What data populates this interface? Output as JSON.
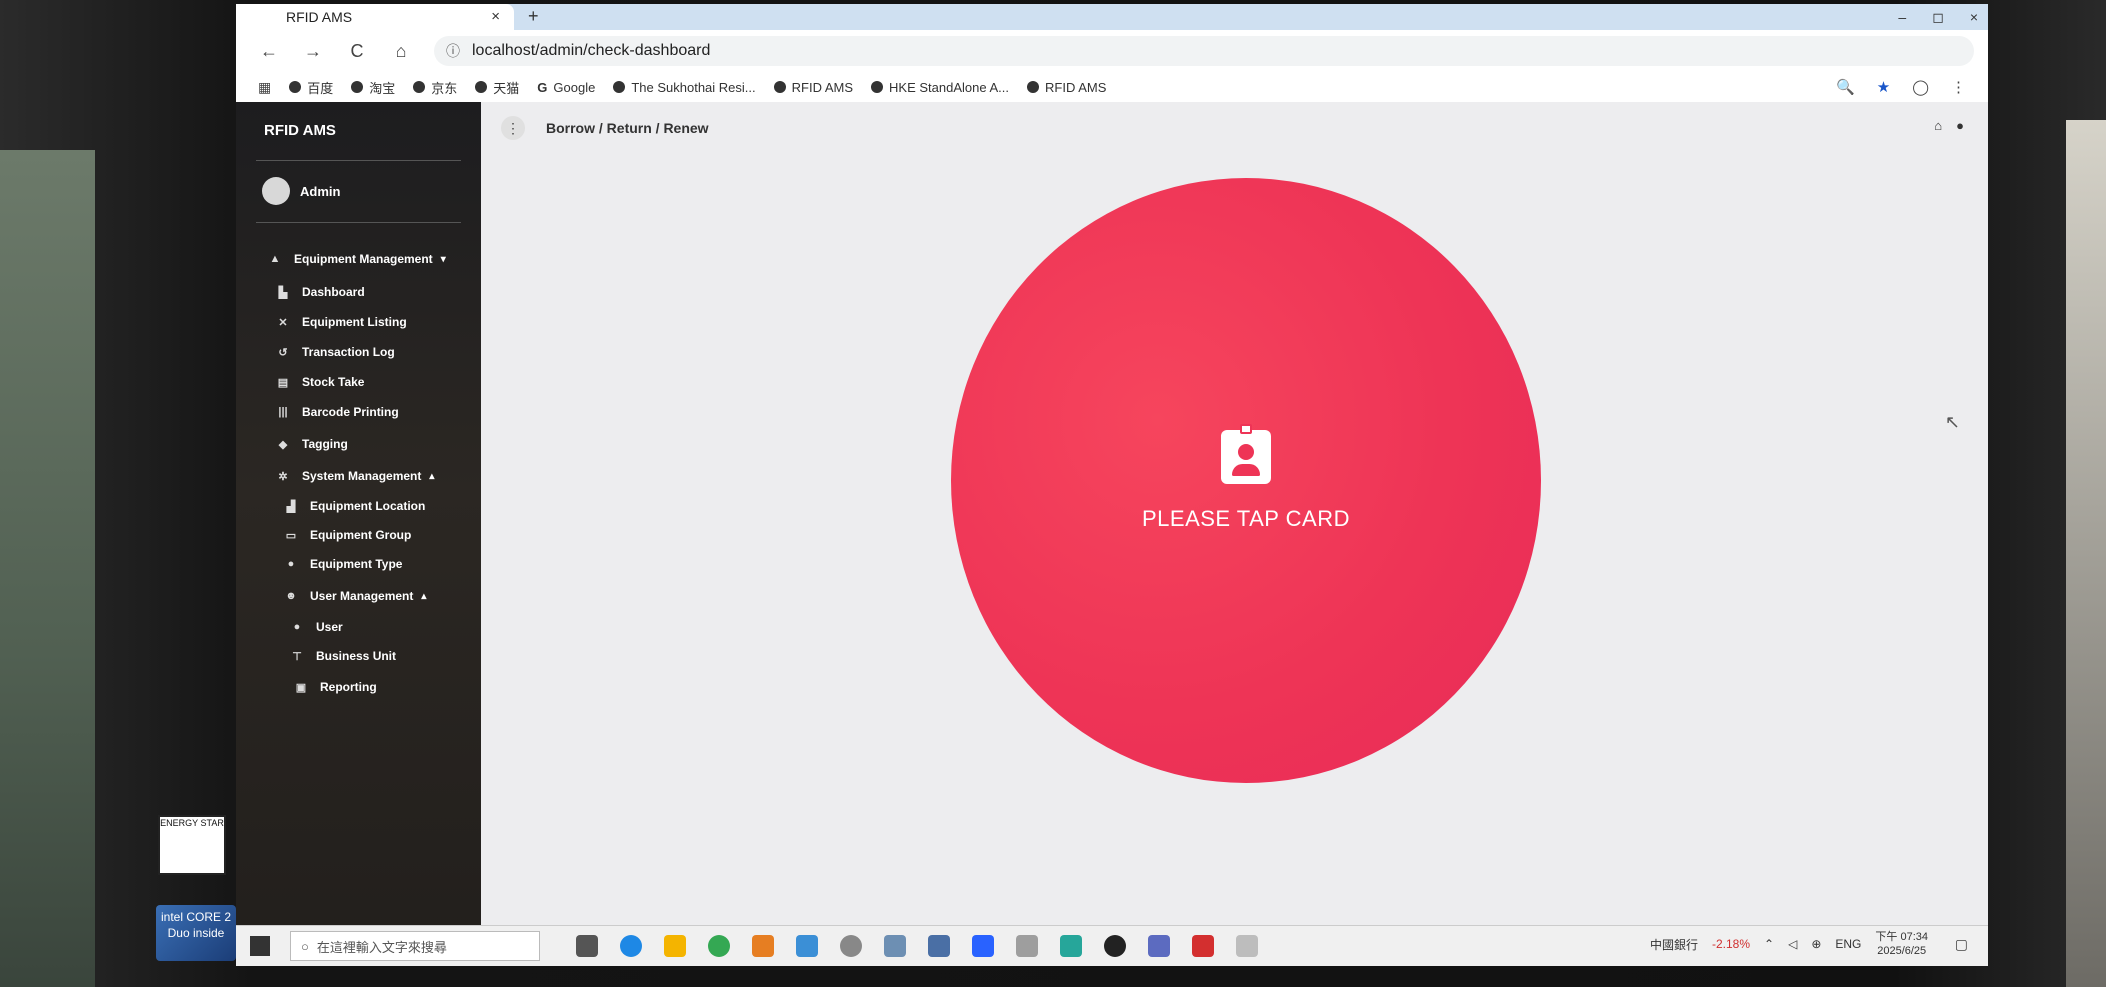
{
  "browser": {
    "tab_title": "RFID AMS",
    "new_tab_symbol": "+",
    "tab_close_symbol": "×",
    "url": "localhost/admin/check-dashboard",
    "nav": {
      "back": "←",
      "forward": "→",
      "reload": "C",
      "home": "⌂"
    },
    "window_controls": [
      "–",
      "◻",
      "×"
    ],
    "bookmarks": [
      "百度",
      "淘宝",
      "京东",
      "天猫",
      "Google",
      "The Sukhothai Resi...",
      "RFID AMS",
      "HKE StandAlone A...",
      "RFID AMS"
    ],
    "right_icons": [
      "🔍",
      "★",
      "◯",
      "⋮"
    ]
  },
  "app": {
    "brand": "RFID AMS",
    "user": "Admin",
    "breadcrumb": "Borrow / Return / Renew",
    "kebab": "⋮",
    "top_icons": [
      "⌂",
      "●"
    ],
    "menu": {
      "equipment_management": "Equipment Management",
      "dashboard": "Dashboard",
      "equipment_listing": "Equipment Listing",
      "transaction_log": "Transaction Log",
      "stock_take": "Stock Take",
      "barcode_printing": "Barcode Printing",
      "tagging": "Tagging",
      "system_management": "System Management",
      "equipment_location": "Equipment Location",
      "equipment_group": "Equipment Group",
      "equipment_type": "Equipment Type",
      "user_management": "User Management",
      "user": "User",
      "business_unit": "Business Unit",
      "reporting": "Reporting"
    },
    "tap_prompt": "PLEASE TAP CARD"
  },
  "taskbar": {
    "search_placeholder": "在這裡輸入文字來搜尋",
    "stock_label": "中國銀行",
    "stock_change": "-2.18%",
    "language": "ENG",
    "time": "下午 07:34",
    "date": "2025/6/25"
  },
  "stickers": {
    "energy": "ENERGY STAR",
    "intel": "intel CORE 2 Duo inside"
  },
  "colors": {
    "accent_circle": "#ee3456",
    "sidebar_bg": "#1d1d1f",
    "tabstrip": "#cfe0f1"
  }
}
